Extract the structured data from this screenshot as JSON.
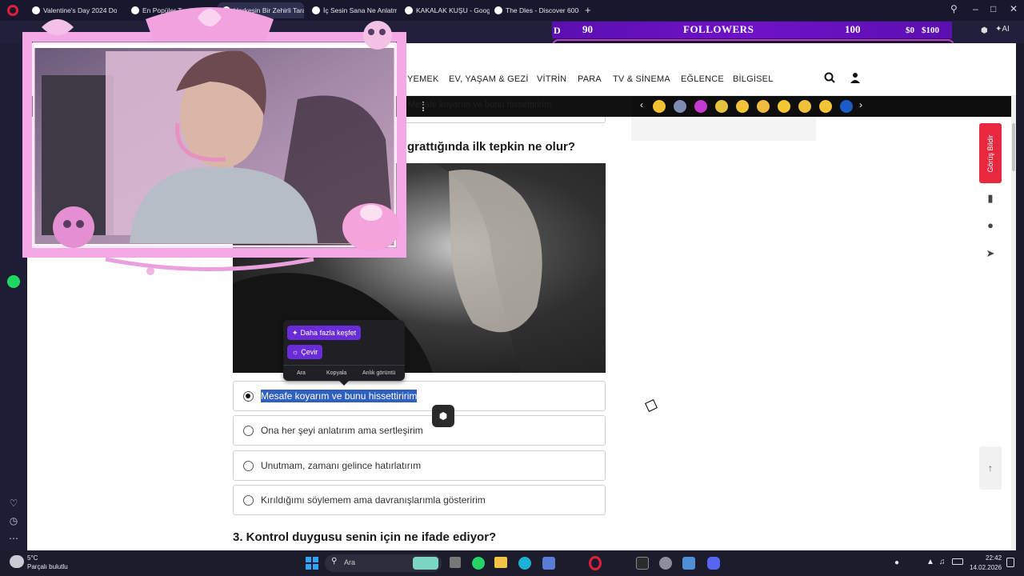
{
  "browser": {
    "tabs": [
      {
        "title": "Valentine's Day 2024 Doo",
        "fav_color": "#ffffff"
      },
      {
        "title": "En Popüler Testler ve",
        "fav_color": "#ffffff"
      },
      {
        "title": "Herkesin Bir Zehirli Taraf",
        "fav_color": "#ffffff"
      },
      {
        "title": "İç Sesin Sana Ne Anlatma",
        "fav_color": "#ffffff"
      },
      {
        "title": "KAKALAK KUŞU - Google",
        "fav_color": "#ffffff"
      },
      {
        "title": "The Dles - Discover 600+",
        "fav_color": "#ffffff"
      }
    ],
    "new_tab": "+",
    "ai_label": "AI"
  },
  "overlay": {
    "left_num": "90",
    "label": "FOLLOWERS",
    "right_num": "100",
    "money1": "$0",
    "money2": "$100",
    "d_letter": "D"
  },
  "site_nav": {
    "items": [
      "YEMEK",
      "EV, YAŞAM & GEZİ",
      "VİTRİN",
      "PARA",
      "TV & SİNEMA",
      "EĞLENCE",
      "BİLGİSEL"
    ]
  },
  "emoji_colors": [
    "#f2c230",
    "#7f8cb3",
    "#c33bd0",
    "#e7c23b",
    "#f3c337",
    "#f0bb3e",
    "#f5c634",
    "#f1c03a",
    "#f3c43a",
    "#1b5cc8"
  ],
  "top_snippet": "Mesafe koyarım ve bunu hissettiririm",
  "question2_tail": "grattığında ilk tepkin ne olur?",
  "options": [
    {
      "label": "Mesafe koyarım ve bunu hissettiririm",
      "checked": true
    },
    {
      "label": "Ona her şeyi anlatırım ama sertleşirim",
      "checked": false
    },
    {
      "label": "Unutmam, zamanı gelince hatırlatırım",
      "checked": false
    },
    {
      "label": "Kırıldığımı söylemem ama davranışlarımla gösteririm",
      "checked": false
    }
  ],
  "question3": "3. Kontrol duygusu senin için ne ifade ediyor?",
  "popup": {
    "explore": "Daha fazla keşfet",
    "translate": "Çevir",
    "actions": [
      "Ara",
      "Kopyala",
      "Anlık görüntü"
    ]
  },
  "gorus_label": "Görüş Bildir",
  "taskbar": {
    "temp": "5°C",
    "weather": "Parçalı bulutlu",
    "search": "Ara",
    "time": "22:42",
    "date": "14.02.2026"
  }
}
